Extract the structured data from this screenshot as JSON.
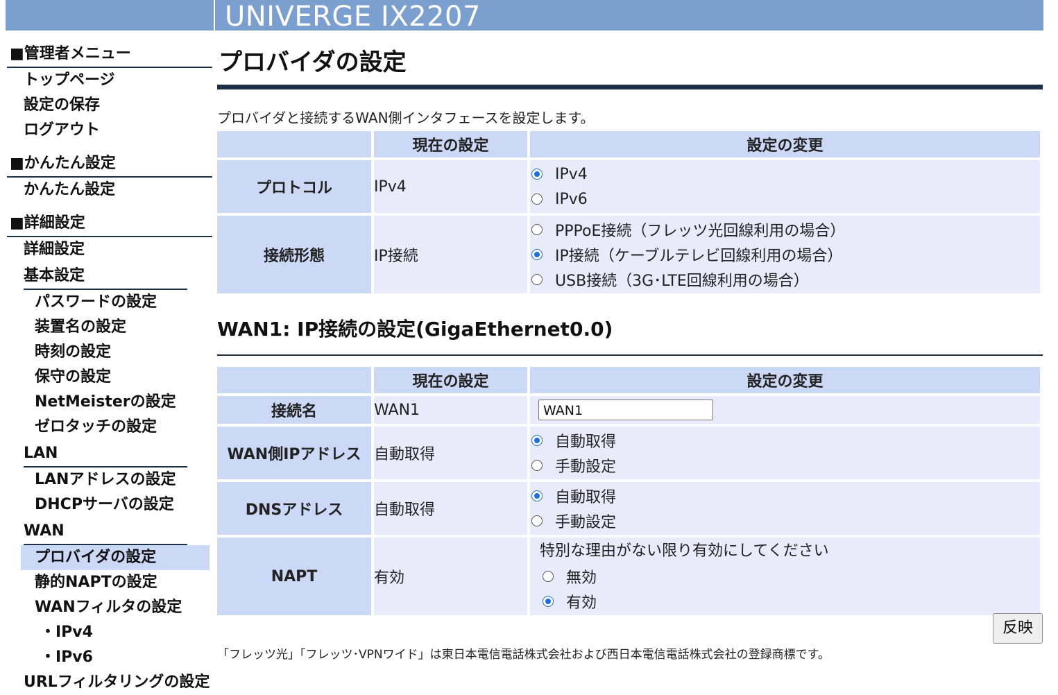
{
  "header": {
    "title": "UNIVERGE IX2207"
  },
  "sidebar": {
    "admin_menu": {
      "title": "■管理者メニュー",
      "items": [
        "トップページ",
        "設定の保存",
        "ログアウト"
      ]
    },
    "easy": {
      "title": "■かんたん設定",
      "items": [
        "かんたん設定"
      ]
    },
    "detail": {
      "title": "■詳細設定",
      "top": "詳細設定",
      "basic": {
        "title": "基本設定",
        "items": [
          "パスワードの設定",
          "装置名の設定",
          "時刻の設定",
          "保守の設定",
          "NetMeisterの設定",
          "ゼロタッチの設定"
        ]
      },
      "lan": {
        "title": "LAN",
        "items": [
          "LANアドレスの設定",
          "DHCPサーバの設定"
        ]
      },
      "wan": {
        "title": "WAN",
        "items": [
          "プロバイダの設定",
          "静的NAPTの設定",
          "WANフィルタの設定"
        ],
        "filter_sub": [
          "・IPv4",
          "・IPv6"
        ],
        "active": "プロバイダの設定"
      },
      "cutoff": "URLフィルタリングの設定"
    }
  },
  "main": {
    "title": "プロバイダの設定",
    "description": "プロバイダと接続するWAN側インタフェースを設定します。",
    "col_current": "現在の設定",
    "col_change": "設定の変更",
    "provider": {
      "protocol": {
        "label": "プロトコル",
        "current": "IPv4",
        "options": [
          "IPv4",
          "IPv6"
        ],
        "selected": "IPv4"
      },
      "connection_type": {
        "label": "接続形態",
        "current": "IP接続",
        "options": [
          "PPPoE接続（フレッツ光回線利用の場合）",
          "IP接続（ケーブルテレビ回線利用の場合）",
          "USB接続（3G･LTE回線利用の場合）"
        ],
        "selected": "IP接続（ケーブルテレビ回線利用の場合）"
      }
    },
    "wan_section_title": "WAN1: IP接続の設定(GigaEthernet0.0)",
    "wan": {
      "connection_name": {
        "label": "接続名",
        "current": "WAN1",
        "input_value": "WAN1"
      },
      "wan_ip": {
        "label": "WAN側IPアドレス",
        "current": "自動取得",
        "options": [
          "自動取得",
          "手動設定"
        ],
        "selected": "自動取得"
      },
      "dns": {
        "label": "DNSアドレス",
        "current": "自動取得",
        "options": [
          "自動取得",
          "手動設定"
        ],
        "selected": "自動取得"
      },
      "napt": {
        "label": "NAPT",
        "current": "有効",
        "note": "特別な理由がない限り有効にしてください",
        "options": [
          "無効",
          "有効"
        ],
        "selected": "有効"
      }
    },
    "apply_label": "反映",
    "footer": "「フレッツ光」「フレッツ･VPNワイド」は東日本電信電話株式会社および西日本電信電話株式会社の登録商標です。"
  },
  "colors": {
    "banner": "#7b9fcf",
    "header_cell": "#ccd9f6",
    "value_cell": "#e7ebfa",
    "rule": "#1d2f47",
    "radio_on": "#1a6fe0"
  }
}
